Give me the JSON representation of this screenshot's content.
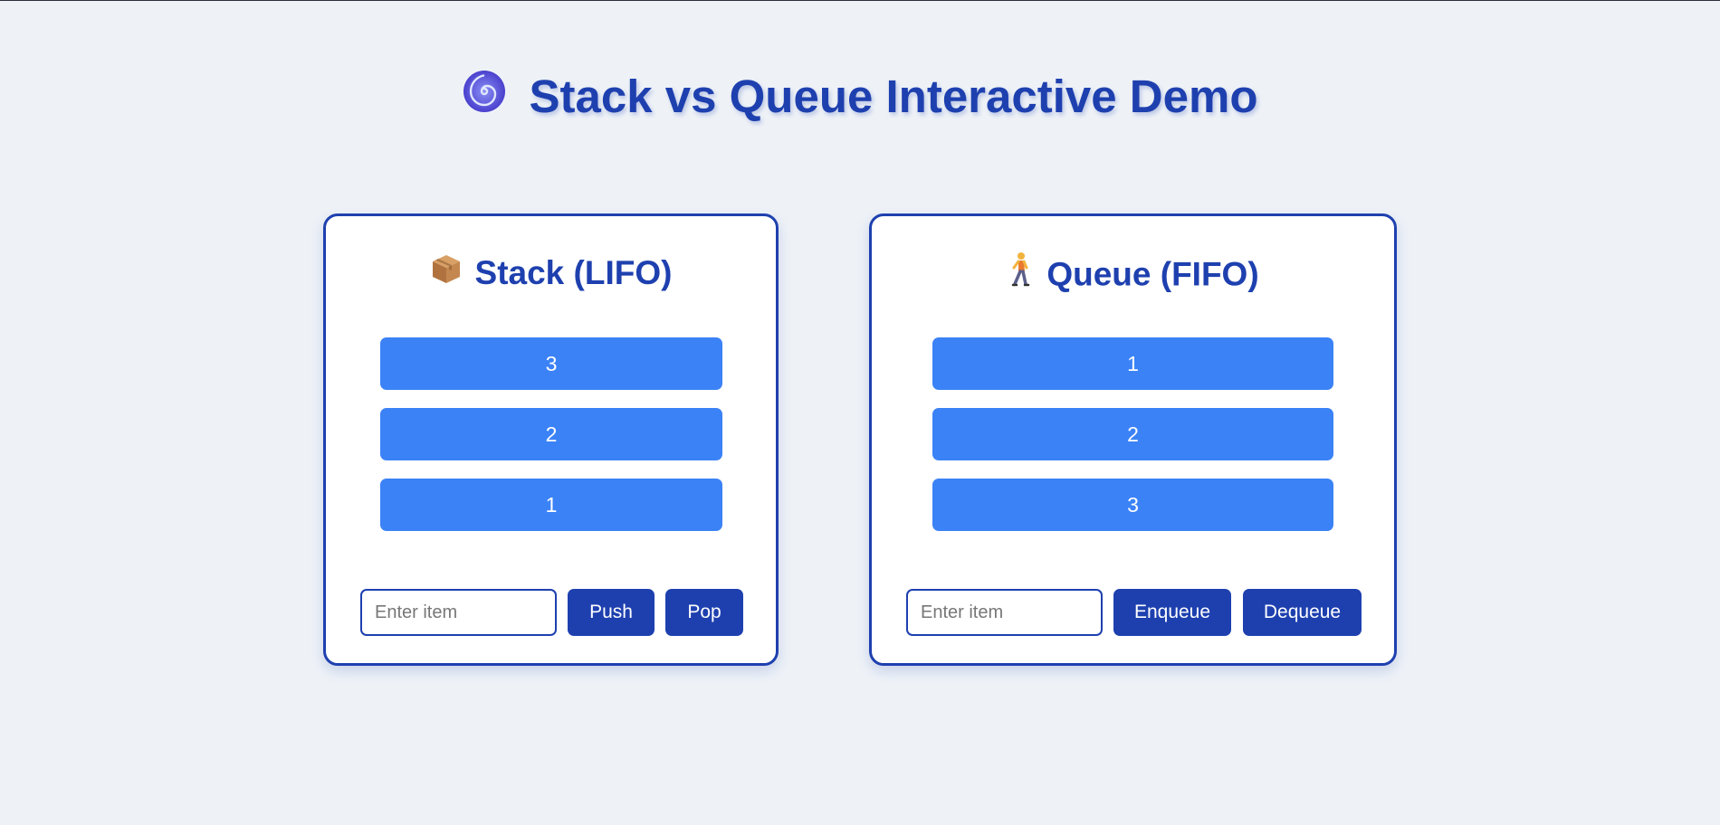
{
  "header": {
    "logo_icon": "cyclone-spiral-icon",
    "title": "Stack vs Queue Interactive Demo"
  },
  "stack": {
    "icon": "package-box-icon",
    "title": "Stack (LIFO)",
    "items": [
      "3",
      "2",
      "1"
    ],
    "input_placeholder": "Enter item",
    "input_value": "",
    "push_label": "Push",
    "pop_label": "Pop"
  },
  "queue": {
    "icon": "walking-person-icon",
    "title": "Queue (FIFO)",
    "items": [
      "1",
      "2",
      "3"
    ],
    "input_placeholder": "Enter item",
    "input_value": "",
    "enqueue_label": "Enqueue",
    "dequeue_label": "Dequeue"
  },
  "colors": {
    "background": "#eef2f7",
    "primary": "#1e40af",
    "item": "#3b82f6",
    "panel": "#ffffff"
  }
}
